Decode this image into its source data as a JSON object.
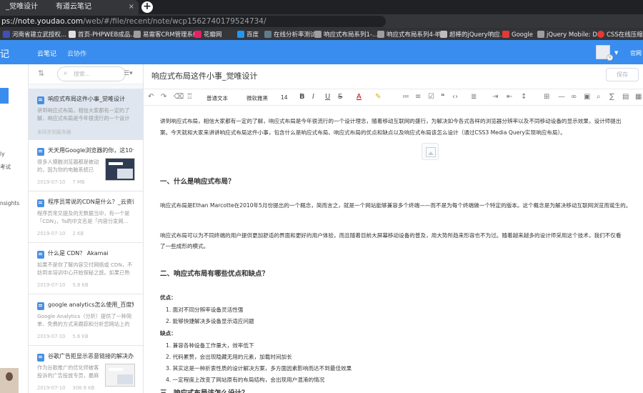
{
  "browser": {
    "tabs": [
      {
        "label": "_觉唯设计",
        "active": false
      },
      {
        "label": "有道云笔记",
        "active": true
      }
    ],
    "new_tab_label": "+",
    "close_label": "×",
    "url_host": "ps://note.youdao.com",
    "url_path": "/web/#/file/recent/note/wcp1562740179524734/",
    "star": "☆",
    "bookmarks": [
      "河南省建立武授权...",
      "首页-PHPWEB成品...",
      "易需客CRM管理系统",
      "花瓣网",
      "百度",
      "在线分析率测试",
      "响应式布局系列1-...",
      "响应式布局系列4-响...",
      "超棒的jQuery响应...",
      "Google",
      "jQuery Mobile: D...",
      "CSS在线压缩工具"
    ]
  },
  "app": {
    "logo": "记",
    "nav_tabs": [
      "云笔记",
      "云协作"
    ],
    "account_label": "官网",
    "left_nav_labels": [
      "ly",
      "考试",
      "nsights"
    ]
  },
  "notelist": {
    "search_placeholder": "搜索...",
    "items": [
      {
        "title": "响应式布局这件小事_觉唯设计",
        "snippet": "讲到响应式布局，相信大家都有一定的了解，响应式布局是今年很流行的一个设计理念，",
        "date": "未同步到服务器",
        "size": "",
        "selected": true,
        "thumb": false
      },
      {
        "title": "天天用Google浏览器的你，这10个插...",
        "snippet": "很多人摸触浏览器都是被动的，因为你的电脑系统已经...",
        "date": "2019-07-10",
        "size": "7 MB",
        "selected": false,
        "thumb": true
      },
      {
        "title": "程序员常说的CDN是什么？_云资讯_...",
        "snippet": "程序员常见提及的无数据当中，有一个是「CDN」，Ta的中文名是「内容分发网...",
        "date": "2019-07-10",
        "size": "2 KB",
        "selected": false,
        "thumb": false
      },
      {
        "title": "什么是 CDN？ Akamai",
        "snippet": "如果不是你了解内容交付网络或 CDN，不妨到本培训中心开始探秘之旅。如果已熟知一...",
        "date": "2019-07-10",
        "size": "5.8 KB",
        "selected": false,
        "thumb": false
      },
      {
        "title": "google analytics怎么使用_百度知道",
        "snippet": "Google Analytics（分析）提供了一种简单、免费的方式来跟踪和分析您网站上的访...",
        "date": "2019-07-10",
        "size": "5.6 KB",
        "selected": false,
        "thumb": false
      },
      {
        "title": "谷歌广告拒显示恶意链接的解决办法",
        "snippet": "作为谷歌推广的优化师被客投诉的广告投放专员，最麻烦...",
        "date": "2019-07-10",
        "size": "306.9 KB",
        "selected": false,
        "thumb": true
      }
    ]
  },
  "editor": {
    "title": "响应式布局这件小事_觉唯设计",
    "save_label": "保存",
    "toolbar": {
      "paragraph_style": "普通文本",
      "font_family": "微软雅黑",
      "font_size": "14"
    },
    "paragraphs": [
      "讲到响应式布局，相信大家都有一定的了解，响应式布局是今年很流行的一个设计理念，随着移动互联网的盛行，为解决如今各式各样的浏览器分辨率以及不同移动设备的显示效果，设计师提出",
      "案。今天就和大家来讲讲响应式布局这件小事，包含什么是响应式布局、响应式布局的优点和缺点以及响应式布局该怎么设计（通过CSS3 Media Query实现响应布局）。"
    ],
    "h1": "一、什么是响应式布局？",
    "p_def1": "响应式布局是Ethan Marcotte在2010年5月份提出的一个概念，简而言之，就是一个网站能够兼容多个终端——而不是为每个终端做一个特定的版本。这个概念是为解决移动互联网浏览而诞生的。",
    "p_def2a": "响应式布局可以为不同终端的用户提供更加舒适的界面和更好的用户体验，而且随着目前大屏幕移动设备的普及，用大势所趋来形容也不为过。随着越来越多的设计师采用这个技术，我们不仅看",
    "p_def2b": "了一些成形的模式。",
    "h2": "二、响应式布局有哪些优点和缺点？",
    "pros_label": "优点：",
    "pros": [
      "1. 面对不同分辨率设备灵活性强",
      "2. 能够快捷解决多设备显示适应问题"
    ],
    "cons_label": "缺点：",
    "cons": [
      "1. 兼容各种设备工作量大，效率低下",
      "2. 代码累赘，会出现隐藏无用的元素，加载时间加长",
      "3. 其实这是一种折衷性质的设计解决方案，多方面因素影响而达不到最佳效果",
      "4. 一定程度上改变了网站原有的布局结构，会出现用户混淆的情况"
    ],
    "h3": "三、响应式布局该怎么设计？"
  }
}
